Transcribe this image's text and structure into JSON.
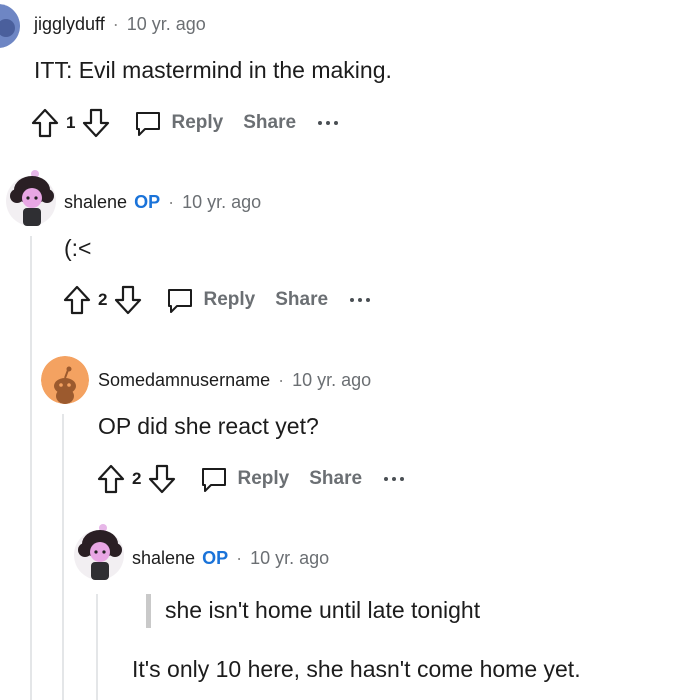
{
  "comments": [
    {
      "author": "jigglyduff",
      "op_badge": "",
      "separator": "·",
      "time": "10 yr. ago",
      "body": "ITT: Evil mastermind in the making.",
      "score": "1",
      "reply_label": "Reply",
      "share_label": "Share"
    },
    {
      "author": "shalene",
      "op_badge": "OP",
      "separator": "·",
      "time": "10 yr. ago",
      "body": "(:<",
      "score": "2",
      "reply_label": "Reply",
      "share_label": "Share"
    },
    {
      "author": "Somedamnusername",
      "op_badge": "",
      "separator": "·",
      "time": "10 yr. ago",
      "body": "OP did she react yet?",
      "score": "2",
      "reply_label": "Reply",
      "share_label": "Share"
    },
    {
      "author": "shalene",
      "op_badge": "OP",
      "separator": "·",
      "time": "10 yr. ago",
      "quote": "she isn't home until late tonight",
      "body": "It's only 10 here, she hasn't come home yet."
    }
  ],
  "colors": {
    "op_badge": "#1a73d9",
    "action_text": "#6b6f73",
    "thread_line": "#e4e6e8",
    "snoo_orange": "#f4a261"
  }
}
